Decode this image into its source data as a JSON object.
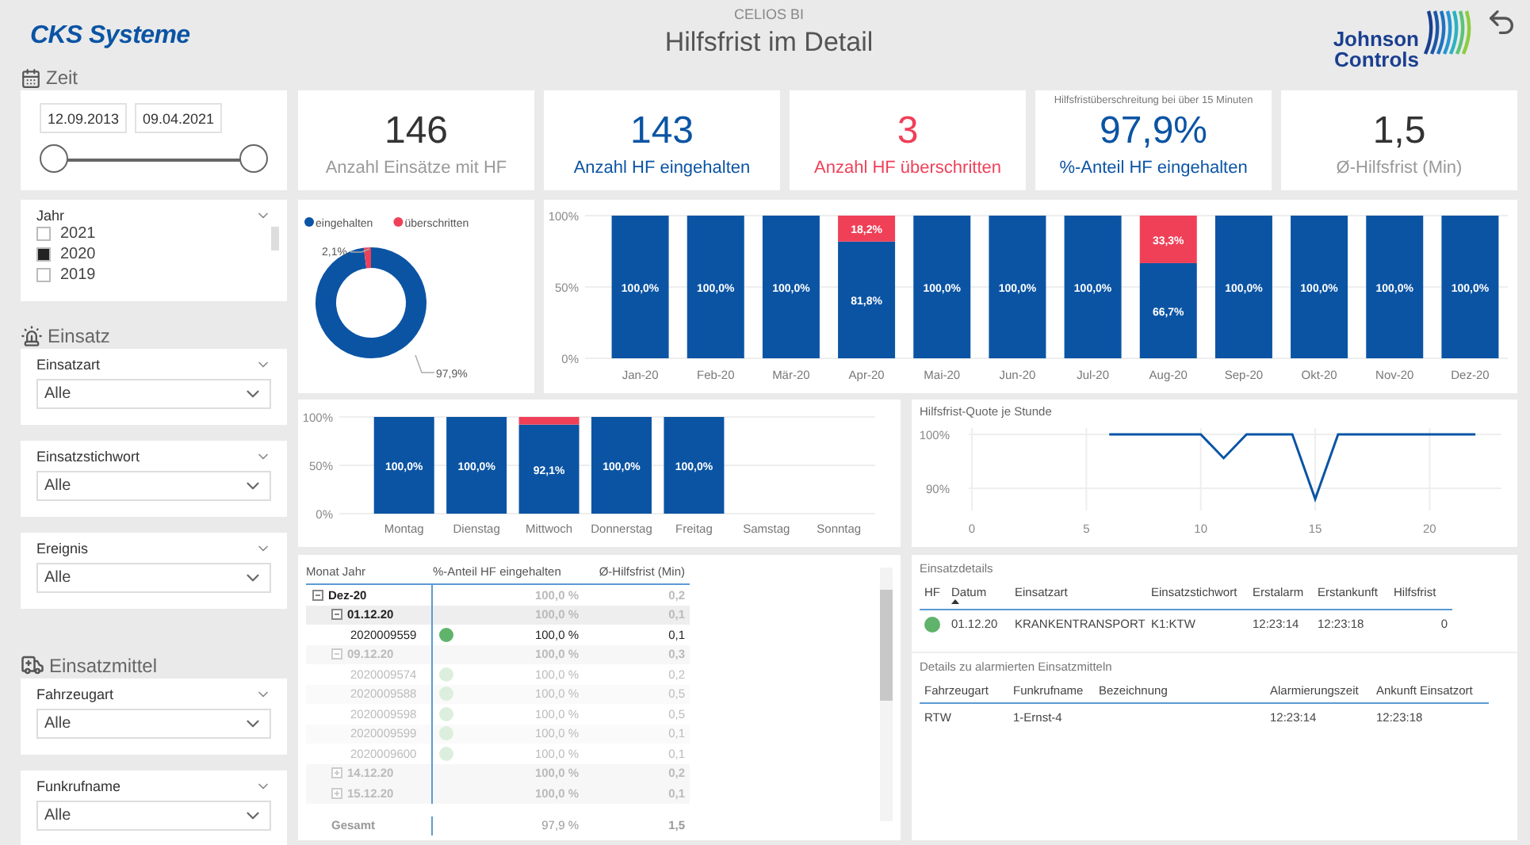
{
  "header": {
    "brand": "CKS Systeme",
    "subtitle": "CELIOS BI",
    "title": "Hilfsfrist im Detail",
    "partner_logo": [
      "Johnson",
      "Controls"
    ]
  },
  "filters": {
    "time": {
      "heading": "Zeit",
      "kind": "time",
      "start": "12.09.2013",
      "end": "09.04.2021",
      "level": 1
    },
    "year": {
      "label": "Jahr",
      "options": [
        {
          "label": "2021",
          "checked": false
        },
        {
          "label": "2020",
          "checked": true
        },
        {
          "label": "2019",
          "checked": false
        }
      ]
    },
    "sections": [
      {
        "heading": "Einsatz",
        "kind": "incident",
        "slicers": [
          {
            "label": "Einsatzart",
            "value": "Alle"
          },
          {
            "label": "Einsatzstichwort",
            "value": "Alle"
          },
          {
            "label": "Ereignis",
            "value": "Alle"
          }
        ]
      },
      {
        "heading": "Einsatzmittel",
        "kind": "resources",
        "slicers": [
          {
            "label": "Fahrzeugart",
            "value": "Alle"
          },
          {
            "label": "Funkrufname",
            "value": "Alle"
          }
        ]
      }
    ]
  },
  "kpis": [
    {
      "kind": "neutral",
      "value": "146",
      "label": "Anzahl Einsätze mit HF"
    },
    {
      "kind": "good",
      "value": "143",
      "label": "Anzahl HF eingehalten"
    },
    {
      "kind": "bad",
      "value": "3",
      "label": "Anzahl HF überschritten"
    },
    {
      "kind": "good",
      "caption": "Hilfsfristüberschreitung bei über 15 Minuten",
      "value": "97,9%",
      "label": "%-Anteil HF eingehalten"
    },
    {
      "kind": "neutral",
      "value": "1,5",
      "label": "Ø-Hilfsfrist (Min)"
    }
  ],
  "donut": {
    "chart_data": {
      "type": "donut",
      "legend": "top",
      "colors": [
        "#0b54a4",
        "#ef4058"
      ],
      "categories": [
        "eingehalten",
        "überschritten"
      ],
      "values": [
        97.9,
        2.1
      ],
      "value_labels": [
        "97,9%",
        "2,1%"
      ]
    }
  },
  "monthly": {
    "chart_data": {
      "type": "bar",
      "stacked": true,
      "categories": [
        "Jan-20",
        "Feb-20",
        "Mär-20",
        "Apr-20",
        "Mai-20",
        "Jun-20",
        "Jul-20",
        "Aug-20",
        "Sep-20",
        "Okt-20",
        "Nov-20",
        "Dez-20"
      ],
      "ylim": [
        0,
        100
      ],
      "yticks": [
        {
          "value": 0,
          "label": "0%"
        },
        {
          "value": 50,
          "label": "50%"
        },
        {
          "value": 100,
          "label": "100%"
        }
      ],
      "data_labels": true,
      "series": [
        {
          "color": "#0b54a4",
          "values": [
            100,
            100,
            100,
            81.8,
            100,
            100,
            100,
            66.7,
            100,
            100,
            100,
            100
          ],
          "value_labels": [
            "100,0%",
            "100,0%",
            "100,0%",
            "81,8%",
            "100,0%",
            "100,0%",
            "100,0%",
            "66,7%",
            "100,0%",
            "100,0%",
            "100,0%",
            "100,0%"
          ]
        },
        {
          "color": "#ef4058",
          "values": [
            0,
            0,
            0,
            18.2,
            0,
            0,
            0,
            33.3,
            0,
            0,
            0,
            0
          ],
          "value_labels": [
            null,
            null,
            null,
            "18,2%",
            null,
            null,
            null,
            "33,3%",
            null,
            null,
            null,
            null
          ]
        }
      ]
    }
  },
  "weekday": {
    "chart_data": {
      "type": "bar",
      "stacked": true,
      "categories": [
        "Montag",
        "Dienstag",
        "Mittwoch",
        "Donnerstag",
        "Freitag",
        "Samstag",
        "Sonntag"
      ],
      "ylim": [
        0,
        100
      ],
      "yticks": [
        {
          "value": 0,
          "label": "0%"
        },
        {
          "value": 50,
          "label": "50%"
        },
        {
          "value": 100,
          "label": "100%"
        }
      ],
      "data_labels": true,
      "series": [
        {
          "color": "#0b54a4",
          "values": [
            100,
            100,
            92.1,
            100,
            100,
            null,
            null
          ],
          "value_labels": [
            "100,0%",
            "100,0%",
            "92,1%",
            "100,0%",
            "100,0%",
            null,
            null
          ]
        },
        {
          "color": "#ef4058",
          "values": [
            0,
            0,
            7.9,
            0,
            0,
            null,
            null
          ],
          "value_labels": [
            null,
            null,
            null,
            null,
            null,
            null,
            null
          ]
        }
      ]
    }
  },
  "hourly": {
    "title": "Hilfsfrist-Quote je Stunde",
    "chart_data": {
      "type": "line",
      "x": [
        6,
        7,
        8,
        9,
        10,
        11,
        12,
        13,
        14,
        15,
        16,
        17,
        18,
        19,
        20,
        21,
        22
      ],
      "xlim": [
        0,
        23
      ],
      "ylim": [
        86,
        101
      ],
      "grid": true,
      "xticks": [
        0,
        5,
        10,
        15,
        20
      ],
      "yticks": [
        {
          "value": 90,
          "label": "90%"
        },
        {
          "value": 100,
          "label": "100%"
        }
      ],
      "series": [
        {
          "color": "#0b54a4",
          "values": [
            100,
            100,
            100,
            100,
            100,
            95.6,
            100,
            100,
            100,
            88,
            100,
            100,
            100,
            100,
            100,
            100,
            100
          ]
        }
      ]
    }
  },
  "matrix": {
    "columns": [
      "Monat Jahr",
      "%-Anteil HF eingehalten",
      "Ø-Hilfsfrist (Min)"
    ],
    "rows": [
      {
        "kind": "month",
        "label": "Dez-20",
        "pct": "100,0 %",
        "avg": "0,2",
        "expanded": true,
        "selected": true,
        "children": [
          {
            "kind": "day",
            "label": "01.12.20",
            "pct": "100,0 %",
            "avg": "0,1",
            "expanded": true,
            "selected": true,
            "children": [
              {
                "kind": "mission",
                "label": "2020009559",
                "pct": "100,0 %",
                "avg": "0,1",
                "selected": true
              }
            ]
          },
          {
            "kind": "day",
            "label": "09.12.20",
            "pct": "100,0 %",
            "avg": "0,3",
            "expanded": true,
            "selected": false,
            "children": [
              {
                "kind": "mission",
                "label": "2020009574",
                "pct": "100,0 %",
                "avg": "0,2",
                "selected": false
              },
              {
                "kind": "mission",
                "label": "2020009588",
                "pct": "100,0 %",
                "avg": "0,5",
                "selected": false
              },
              {
                "kind": "mission",
                "label": "2020009598",
                "pct": "100,0 %",
                "avg": "0,5",
                "selected": false
              },
              {
                "kind": "mission",
                "label": "2020009599",
                "pct": "100,0 %",
                "avg": "0,1",
                "selected": false
              },
              {
                "kind": "mission",
                "label": "2020009600",
                "pct": "100,0 %",
                "avg": "0,1",
                "selected": false
              }
            ]
          },
          {
            "kind": "day",
            "label": "14.12.20",
            "pct": "100,0 %",
            "avg": "0,2",
            "expanded": false,
            "selected": false
          },
          {
            "kind": "day",
            "label": "15.12.20",
            "pct": "100,0 %",
            "avg": "0,1",
            "expanded": false,
            "selected": false
          }
        ]
      }
    ],
    "total": {
      "label": "Gesamt",
      "pct": "97,9 %",
      "avg": "1,5"
    }
  },
  "details": {
    "title": "Einsatzdetails",
    "columns": [
      "HF",
      "Datum",
      "Einsatzart",
      "Einsatzstichwort",
      "Erstalarm",
      "Erstankunft",
      "Hilfsfrist"
    ],
    "rows": [
      {
        "hf_met": true,
        "cells": [
          "",
          "01.12.20",
          "KRANKENTRANSPORT",
          "K1:KTW",
          "12:23:14",
          "12:23:18",
          "0"
        ]
      }
    ]
  },
  "resources": {
    "title": "Details zu alarmierten Einsatzmitteln",
    "columns": [
      "Fahrzeugart",
      "Funkrufname",
      "Bezeichnung",
      "Alarmierungszeit",
      "Ankunft Einsatzort"
    ],
    "rows": [
      {
        "cells": [
          "RTW",
          "1-Ernst-4",
          null,
          "12:23:14",
          "12:23:18"
        ]
      }
    ]
  }
}
